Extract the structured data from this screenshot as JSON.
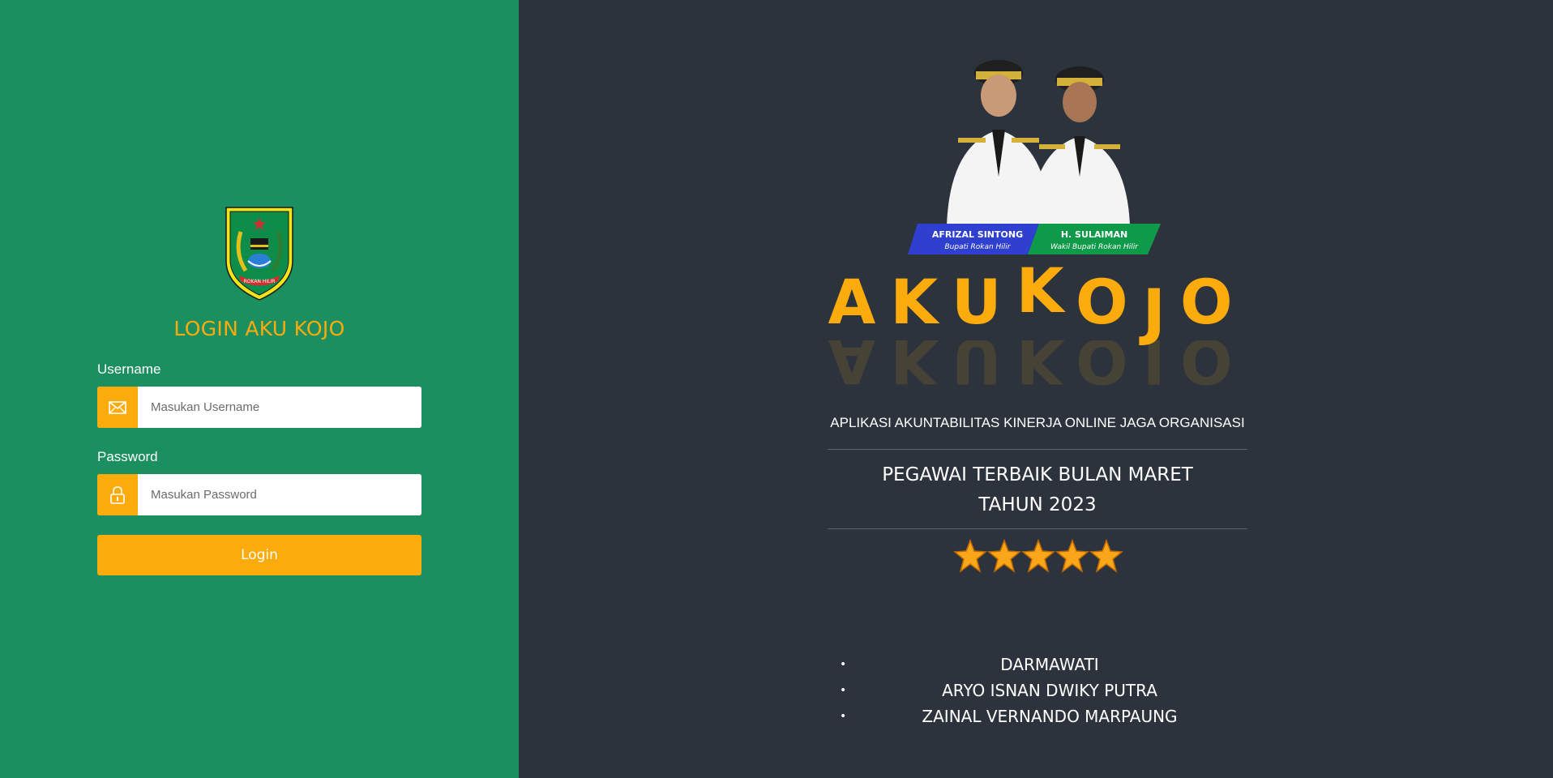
{
  "login": {
    "title": "LOGIN AKU KOJO",
    "emblem_text": "ROKAN HILIR",
    "username_label": "Username",
    "username_placeholder": "Masukan Username",
    "password_label": "Password",
    "password_placeholder": "Masukan Password",
    "button_label": "Login"
  },
  "leaders": [
    {
      "name": "AFRIZAL SINTONG",
      "role": "Bupati Rokan Hilir"
    },
    {
      "name": "H. SULAIMAN",
      "role": "Wakil Bupati Rokan Hilir"
    }
  ],
  "brand": {
    "letters": [
      "A",
      "K",
      "U",
      "K",
      "O",
      "J",
      "O"
    ],
    "subtitle": "APLIKASI AKUNTABILITAS KINERJA ONLINE JAGA ORGANISASI"
  },
  "best_employee": {
    "title_line1": "PEGAWAI TERBAIK BULAN MARET",
    "title_line2": "TAHUN 2023",
    "rating": 5,
    "names": [
      "DARMAWATI",
      "ARYO ISNAN DWIKY PUTRA",
      "ZAINAL VERNANDO MARPAUNG"
    ]
  },
  "colors": {
    "left_panel": "#1b8f5f",
    "right_panel": "#2d333c",
    "accent": "#fbab0b",
    "leader1_banner": "#2f3fd0",
    "leader2_banner": "#0f9a4a"
  },
  "icons": {
    "username_addon": "envelope-icon",
    "password_addon": "lock-icon",
    "rating": "star-icon"
  }
}
